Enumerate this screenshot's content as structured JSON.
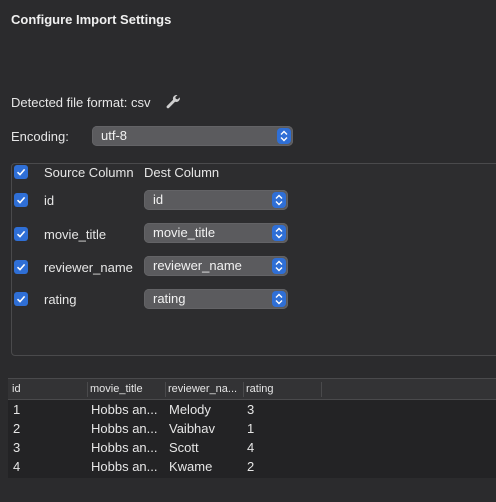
{
  "title": "Configure Import Settings",
  "format": {
    "label": "Detected file format: csv",
    "icon": "wrench-icon"
  },
  "encoding": {
    "label": "Encoding:",
    "value": "utf-8"
  },
  "mapping": {
    "header_source": "Source Column",
    "header_dest": "Dest Column",
    "rows": [
      {
        "source": "id",
        "dest": "id",
        "checked": true
      },
      {
        "source": "movie_title",
        "dest": "movie_title",
        "checked": true
      },
      {
        "source": "reviewer_name",
        "dest": "reviewer_name",
        "checked": true
      },
      {
        "source": "rating",
        "dest": "rating",
        "checked": true
      }
    ]
  },
  "preview": {
    "columns": [
      "id",
      "movie_title",
      "reviewer_na...",
      "rating"
    ],
    "rows": [
      [
        "1",
        "Hobbs an...",
        "Melody",
        "3"
      ],
      [
        "2",
        "Hobbs an...",
        "Vaibhav",
        "1"
      ],
      [
        "3",
        "Hobbs an...",
        "Scott",
        "4"
      ],
      [
        "4",
        "Hobbs an...",
        "Kwame",
        "2"
      ]
    ]
  },
  "colors": {
    "accent": "#2f6fd6",
    "background": "#2b2b2d",
    "control": "#5b5b5e"
  }
}
